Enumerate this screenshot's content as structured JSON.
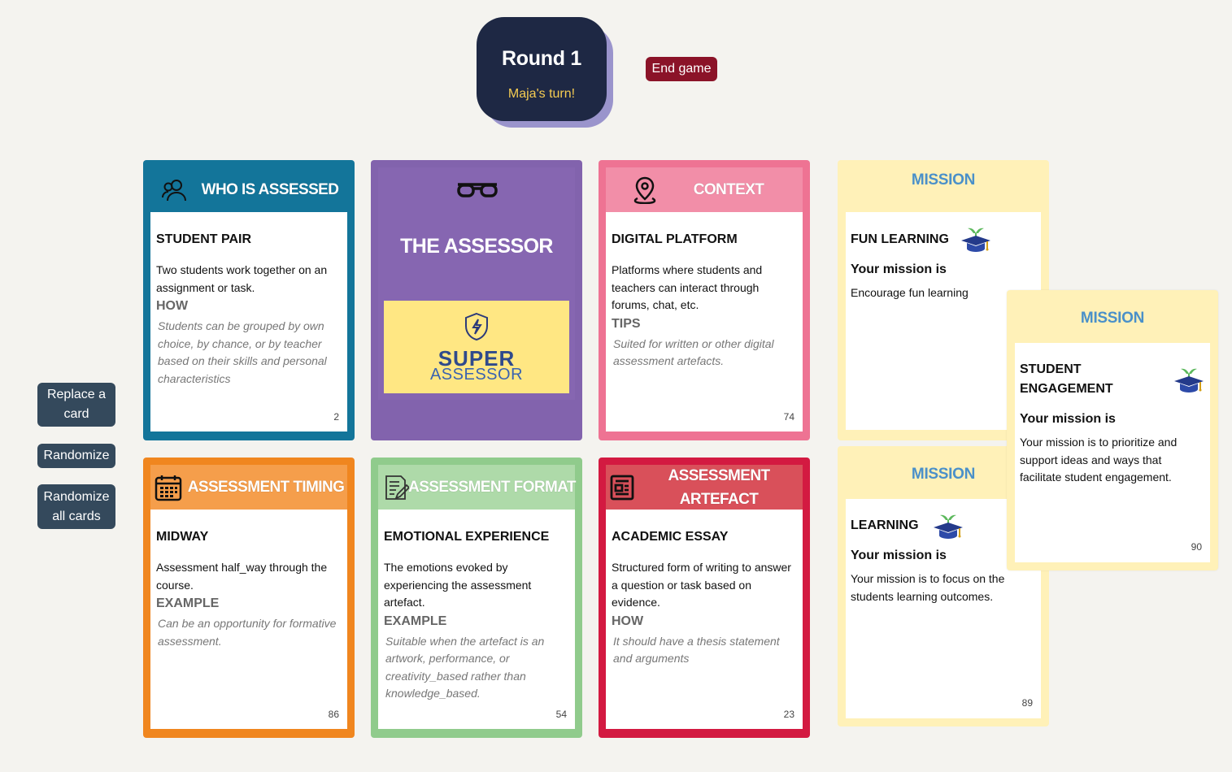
{
  "round": {
    "title": "Round 1",
    "turn": "Maja's turn!"
  },
  "end_game": "End game",
  "side": {
    "replace": "Replace a card",
    "randomize": "Randomize",
    "randomize_all": "Randomize all cards"
  },
  "cards": {
    "who": {
      "category": "WHO IS ASSESSED",
      "title": "STUDENT PAIR",
      "desc": "Two students work together on an assignment or task.",
      "sub": "HOW",
      "italic": "Students can be grouped by own choice, by chance, or by teacher based on their skills and personal characteristics",
      "num": "2",
      "icon": "people-icon",
      "color": "#13759a"
    },
    "assessor": {
      "title": "THE ASSESSOR",
      "badge_line1": "SUPER",
      "badge_line2": "ASSESSOR",
      "icon": "glasses-icon",
      "color": "#8263ad"
    },
    "context": {
      "category": "CONTEXT",
      "title": "DIGITAL PLATFORM",
      "desc": "Platforms where students and teachers can interact through forums, chat, etc.",
      "sub": "TIPS",
      "italic": "Suited for written or other digital assessment artefacts.",
      "num": "74",
      "icon": "location-pin-icon",
      "color": "#ee7393"
    },
    "timing": {
      "category": "ASSESSMENT TIMING",
      "title": "MIDWAY",
      "desc": "Assessment half_way through the course.",
      "sub": "EXAMPLE",
      "italic": "Can be an opportunity for formative assessment.",
      "num": "86",
      "icon": "calendar-icon",
      "color": "#f0861f"
    },
    "format": {
      "category": "ASSESSMENT FORMAT",
      "title": "EMOTIONAL EXPERIENCE",
      "desc": "The emotions evoked by experiencing the assessment artefact.",
      "sub": "EXAMPLE",
      "italic": "Suitable when the artefact is an artwork, performance, or creativity_based rather than knowledge_based.",
      "num": "54",
      "icon": "document-pen-icon",
      "color": "#90cb8c"
    },
    "artefact": {
      "category": "ASSESSMENT ARTEFACT",
      "title": "ACADEMIC ESSAY",
      "desc": "Structured form of writing to answer a question or task based on evidence.",
      "sub": "HOW",
      "italic": "It should have a thesis statement and arguments",
      "num": "23",
      "icon": "newspaper-icon",
      "color": "#d31a41"
    }
  },
  "missions": [
    {
      "head": "MISSION",
      "title": "FUN LEARNING",
      "sub": "Your mission is",
      "text": "Encourage fun learning",
      "num": ""
    },
    {
      "head": "MISSION",
      "title": "LEARNING",
      "sub": "Your mission is",
      "text": "Your mission is to focus on the students learning outcomes.",
      "num": "89"
    },
    {
      "head": "MISSION",
      "title": "STUDENT ENGAGEMENT",
      "sub": "Your mission is",
      "text": "Your mission is to prioritize and support ideas and ways that facilitate student engagement.",
      "num": "90"
    }
  ]
}
